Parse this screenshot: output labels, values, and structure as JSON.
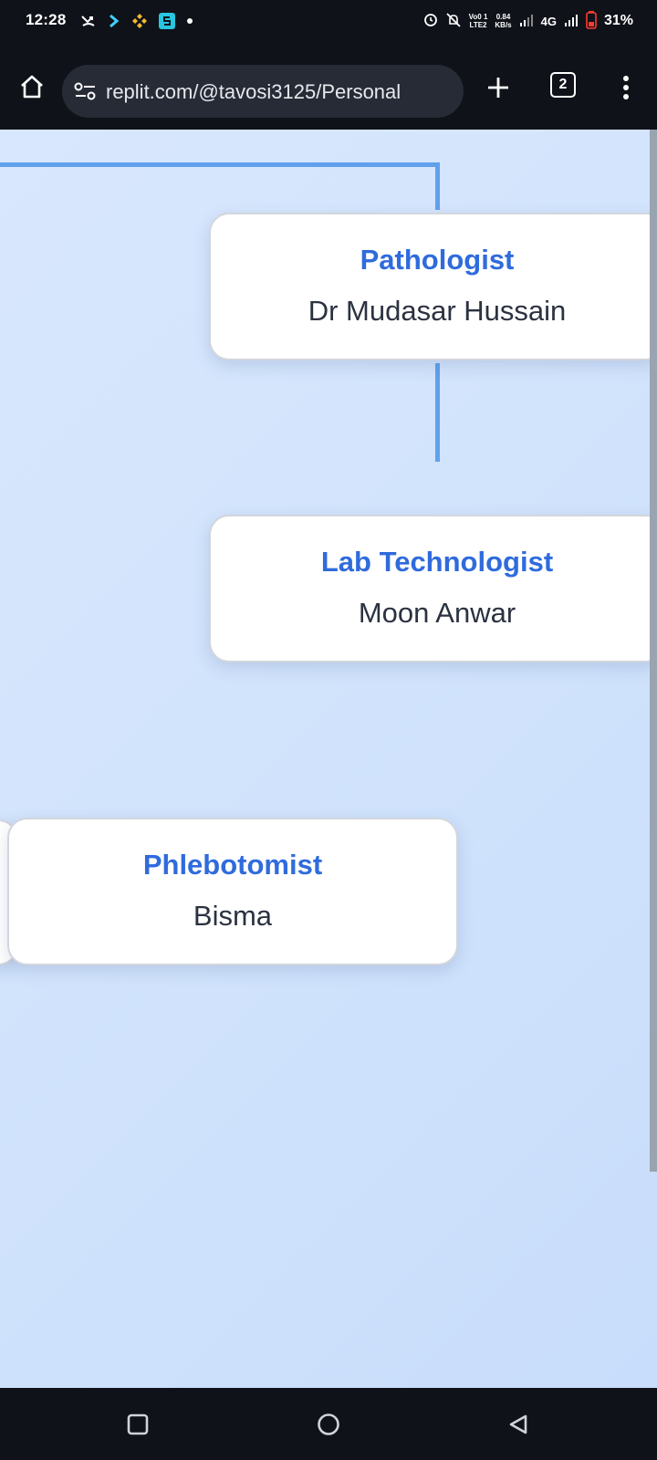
{
  "status_bar": {
    "time": "12:28",
    "volte_top": "Vo0 1",
    "volte_bottom": "LTE2",
    "speed_value": "0.84",
    "speed_unit": "KB/s",
    "network": "4G",
    "battery_percent": "31%"
  },
  "browser": {
    "url": "replit.com/@tavosi3125/Personal",
    "tab_count": "2"
  },
  "org_chart": {
    "nodes": [
      {
        "role": "Pathologist",
        "name": "Dr Mudasar Hussain"
      },
      {
        "role": "Lab Technologist",
        "name": "Moon Anwar"
      },
      {
        "role": "Phlebotomist",
        "name": "Bisma"
      }
    ]
  },
  "colors": {
    "role_text": "#2f6bdc",
    "connector": "#60a1ec",
    "background": "#d4e5fc"
  },
  "icons": {
    "status_left": [
      "missed-call-icon",
      "chevron-app-icon",
      "binance-icon",
      "s-app-icon",
      "dot-icon"
    ],
    "status_right": [
      "alarm-icon",
      "mute-icon",
      "signal-icon",
      "battery-icon"
    ]
  }
}
